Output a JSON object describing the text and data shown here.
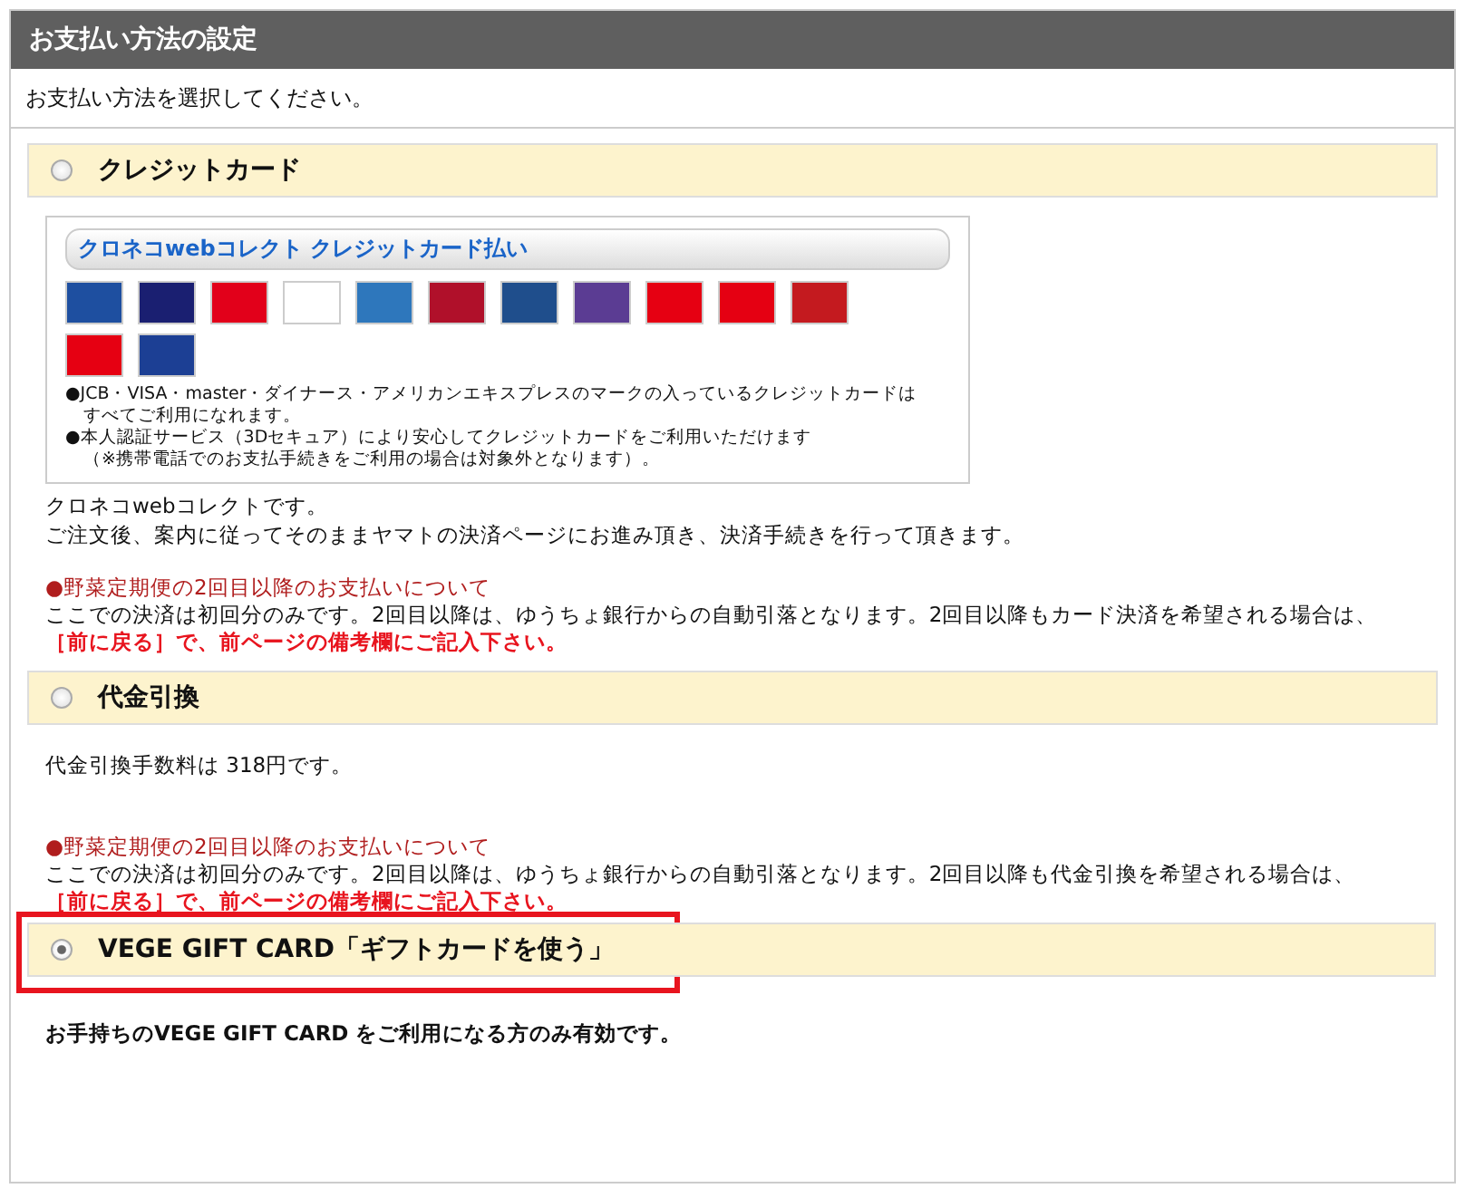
{
  "title": "お支払い方法の設定",
  "instruction": "お支払い方法を選択してください。",
  "methods": [
    {
      "kind": "credit",
      "label": "クレジットカード",
      "selected": false,
      "highlighted": false,
      "panel": {
        "title": "クロネコwebコレクト クレジットカード払い",
        "bullets": [
          "●JCB・VISA・master・ダイナース・アメリカンエキスプレスのマークの入っているクレジットカードは",
          "すべてご利用になれます。",
          "●本人認証サービス（3Dセキュア）により安心してクレジットカードをご利用いただけます",
          "（※携帯電話でのお支払手続きをご利用の場合は対象外となります）。"
        ]
      },
      "paragraphs": [
        "クロネコwebコレクトです。",
        "ご注文後、案内に従ってそのままヤマトの決済ページにお進み頂き、決済手続きを行って頂きます。"
      ],
      "notice": {
        "title": "●野菜定期便の2回目以降のお支払いについて",
        "body": "ここでの決済は初回分のみです。2回目以降は、ゆうちょ銀行からの自動引落となります。2回目以降もカード決済を希望される場合は、",
        "action": "［前に戻る］で、前ページの備考欄にご記入下さい。"
      }
    },
    {
      "kind": "cod",
      "label": "代金引換",
      "selected": false,
      "highlighted": false,
      "paragraphs": [
        "代金引換手数料は 318円です。"
      ],
      "notice": {
        "title": "●野菜定期便の2回目以降のお支払いについて",
        "body": "ここでの決済は初回分のみです。2回目以降は、ゆうちょ銀行からの自動引落となります。2回目以降も代金引換を希望される場合は、",
        "action": "［前に戻る］で、前ページの備考欄にご記入下さい。"
      }
    },
    {
      "kind": "gift",
      "label": "VEGE GIFT CARD「ギフトカードを使う」",
      "selected": true,
      "highlighted": true,
      "paragraphs": [
        "お手持ちのVEGE GIFT CARD をご利用になる方のみ有効です。"
      ]
    }
  ]
}
